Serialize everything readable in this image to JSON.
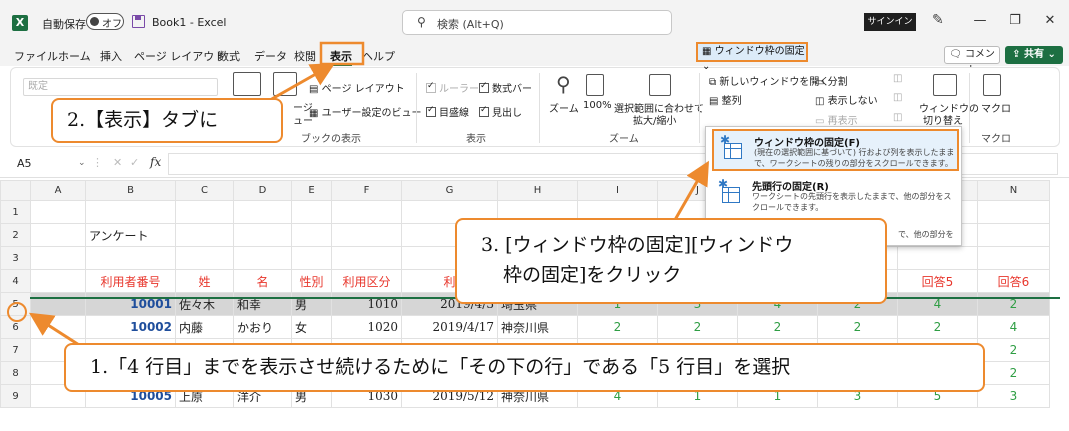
{
  "titlebar": {
    "app_icon_label": "X",
    "autosave_label": "自動保存",
    "autosave_state": "オフ",
    "doc_title": "Book1 - Excel",
    "search_placeholder": "検索 (Alt+Q)",
    "signin_label": "サインイン"
  },
  "tabs": [
    "ファイル",
    "ホーム",
    "挿入",
    "ページ レイアウト",
    "数式",
    "データ",
    "校閲",
    "表示",
    "ヘルプ"
  ],
  "active_tab": "表示",
  "comment_label": "コメント",
  "share_label": "共有",
  "ribbon": {
    "preset_label": "既定",
    "page_layout": "ページ レイアウト",
    "page_small": "ージ",
    "page_small2": "ュー",
    "user_view": "ユーザー設定のビュー",
    "book_view_group": "ブックの表示",
    "ruler": "ルーラー",
    "formula_bar": "数式バー",
    "gridlines": "目盛線",
    "headings": "見出し",
    "show_group": "表示",
    "zoom": "ズーム",
    "zoom100": "100%",
    "zoom_sel_1": "選択範囲に合わせて",
    "zoom_sel_2": "拡大/縮小",
    "zoom_group": "ズーム",
    "new_window": "新しいウィンドウを開く",
    "split": "分割",
    "arrange": "整列",
    "hide": "表示しない",
    "freeze": "ウィンドウ枠の固定",
    "unhide": "再表示",
    "switch_1": "ウィンドウの",
    "switch_2": "切り替え",
    "macro": "マクロ",
    "macro_group": "マクロ"
  },
  "formula_bar": {
    "name_box": "A5",
    "fx": "fx"
  },
  "dropdown": {
    "item1_title": "ウィンドウ枠の固定(F)",
    "item1_desc": "(現在の選択範囲に基づいて) 行および列を表示したままで、ワークシートの残りの部分をスクロールできます。",
    "item2_title": "先頭行の固定(R)",
    "item2_desc": "ワークシートの先頭行を表示したままで、他の部分をスクロールできます。",
    "item3_desc_tail": "で、他の部分を"
  },
  "sheet": {
    "columns": [
      "A",
      "B",
      "C",
      "D",
      "E",
      "F",
      "G",
      "H",
      "I",
      "J",
      "K",
      "L",
      "M",
      "N"
    ],
    "rows": [
      {
        "n": "1",
        "cells": [
          "",
          "",
          "",
          "",
          "",
          "",
          "",
          "",
          "",
          "",
          "",
          "",
          "",
          ""
        ]
      },
      {
        "n": "2",
        "cells": [
          "",
          "アンケート",
          "",
          "",
          "",
          "",
          "",
          "",
          "",
          "",
          "",
          "",
          "",
          ""
        ]
      },
      {
        "n": "3",
        "cells": [
          "",
          "",
          "",
          "",
          "",
          "",
          "",
          "",
          "",
          "",
          "",
          "",
          "",
          ""
        ]
      },
      {
        "n": "4",
        "cells": [
          "",
          "利用者番号",
          "姓",
          "名",
          "性別",
          "利用区分",
          "利",
          "",
          "",
          "",
          "",
          "",
          "回答5",
          "回答6"
        ]
      },
      {
        "n": "5",
        "cells": [
          "",
          "10001",
          "佐々木",
          "和幸",
          "男",
          "1010",
          "2019/4/3",
          "埼玉県",
          "1",
          "3",
          "4",
          "2",
          "4",
          "2"
        ]
      },
      {
        "n": "6",
        "cells": [
          "",
          "10002",
          "内藤",
          "かおり",
          "女",
          "1020",
          "2019/4/17",
          "神奈川県",
          "2",
          "2",
          "2",
          "2",
          "2",
          "4"
        ]
      },
      {
        "n": "7",
        "cells": [
          "",
          "",
          "",
          "",
          "",
          "",
          "",
          "",
          "",
          "",
          "",
          "",
          "",
          "2"
        ]
      },
      {
        "n": "8",
        "cells": [
          "",
          "",
          "",
          "",
          "",
          "",
          "",
          "",
          "",
          "",
          "",
          "",
          "",
          "2"
        ]
      },
      {
        "n": "9",
        "cells": [
          "",
          "10005",
          "上原",
          "洋介",
          "男",
          "1030",
          "2019/5/12",
          "神奈川県",
          "4",
          "1",
          "1",
          "3",
          "5",
          "3"
        ]
      }
    ]
  },
  "callouts": {
    "step2": "2.【表示】タブに",
    "step3_line1": "3. [ウィンドウ枠の固定][ウィンドウ",
    "step3_line2": "枠の固定]をクリック",
    "step1": "1.「4 行目」までを表示させ続けるために「その下の行」である「5 行目」を選択"
  },
  "colors": {
    "accent": "#ed8a2e",
    "excel_green": "#1d6f42",
    "header_red": "#e8362c",
    "id_blue": "#1f4e9c",
    "answer_green": "#2f9e44"
  }
}
